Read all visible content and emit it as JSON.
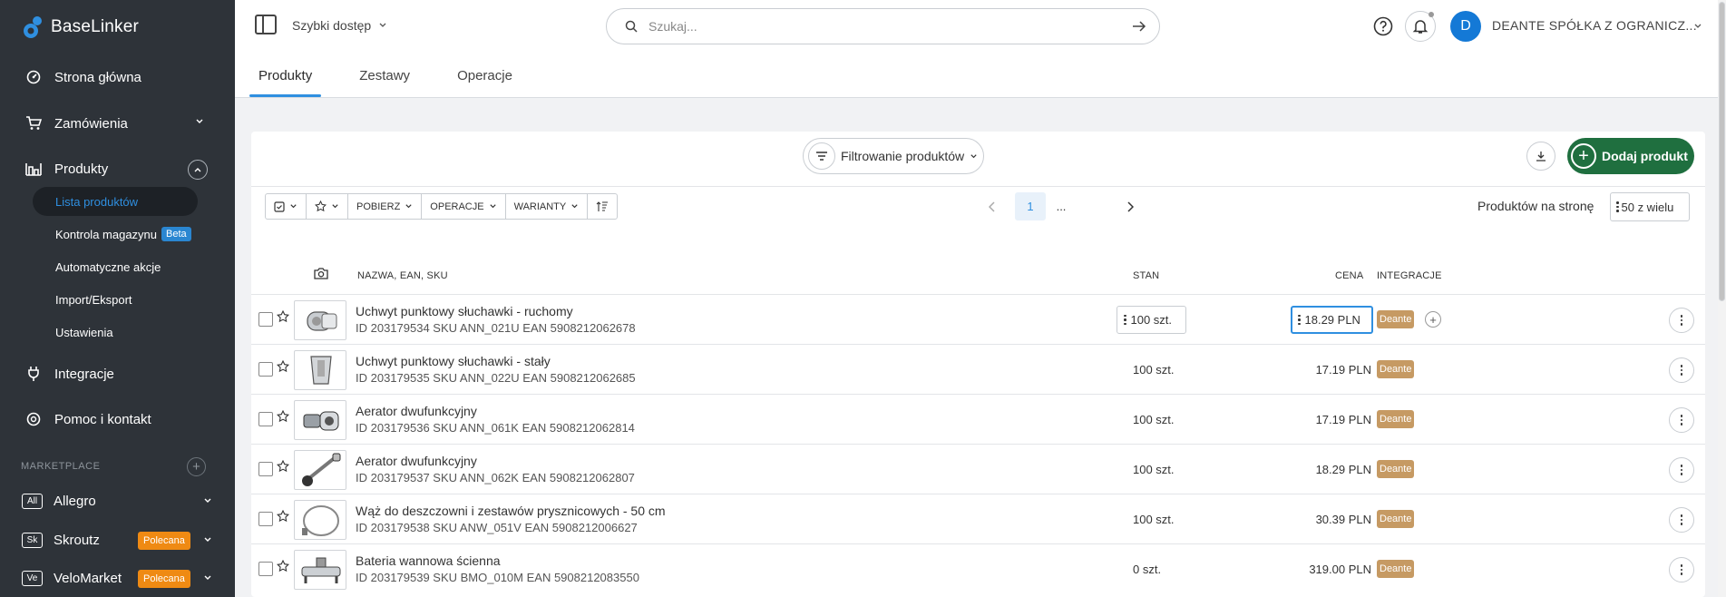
{
  "brand": {
    "name": "BaseLinker"
  },
  "sidebar": {
    "nav": [
      {
        "label": "Strona główna",
        "icon": "dashboard-icon"
      },
      {
        "label": "Zamówienia",
        "icon": "cart-icon"
      },
      {
        "label": "Produkty",
        "icon": "products-icon"
      },
      {
        "label": "Integracje",
        "icon": "plug-icon"
      },
      {
        "label": "Pomoc i kontakt",
        "icon": "help-icon"
      }
    ],
    "product_sub": [
      {
        "label": "Lista produktów"
      },
      {
        "label": "Kontrola magazynu",
        "badge": "Beta"
      },
      {
        "label": "Automatyczne akcje"
      },
      {
        "label": "Import/Eksport"
      },
      {
        "label": "Ustawienia"
      }
    ],
    "marketplace_label": "MARKETPLACE",
    "marketplaces": [
      {
        "badge": "All",
        "label": "Allegro"
      },
      {
        "badge": "Sk",
        "label": "Skroutz",
        "tag": "Polecana"
      },
      {
        "badge": "Ve",
        "label": "VeloMarket",
        "tag": "Polecana"
      }
    ]
  },
  "header": {
    "quick_access": "Szybki dostęp",
    "search_placeholder": "Szukaj...",
    "avatar_initial": "D",
    "company": "DEANTE SPÓŁKA Z OGRANICZ...",
    "tabs": [
      "Produkty",
      "Zestawy",
      "Operacje"
    ]
  },
  "toolbar": {
    "filter_label": "Filtrowanie produktów",
    "add_label": "Dodaj produkt",
    "buttons": [
      "POBIERZ",
      "OPERACJE",
      "WARIANTY"
    ],
    "page_current": "1",
    "page_more": "...",
    "per_page_label": "Produktów na stronę",
    "per_page_value": "50 z wielu"
  },
  "table": {
    "headers": {
      "name": "NAZWA, EAN, SKU",
      "stock": "STAN",
      "price": "CENA",
      "integrations": "INTEGRACJE"
    },
    "rows": [
      {
        "name": "Uchwyt punktowy słuchawki - ruchomy",
        "meta": "ID 203179534 SKU ANN_021U EAN 5908212062678",
        "stock": "100 szt.",
        "price": "18.29 PLN",
        "integration": "Deante",
        "thumb": "holder-mobile"
      },
      {
        "name": "Uchwyt punktowy słuchawki - stały",
        "meta": "ID 203179535 SKU ANN_022U EAN 5908212062685",
        "stock": "100 szt.",
        "price": "17.19 PLN",
        "integration": "Deante",
        "thumb": "holder-fixed"
      },
      {
        "name": "Aerator dwufunkcyjny",
        "meta": "ID 203179536 SKU ANN_061K EAN 5908212062814",
        "stock": "100 szt.",
        "price": "17.19 PLN",
        "integration": "Deante",
        "thumb": "aerator-short"
      },
      {
        "name": "Aerator dwufunkcyjny",
        "meta": "ID 203179537 SKU ANN_062K EAN 5908212062807",
        "stock": "100 szt.",
        "price": "18.29 PLN",
        "integration": "Deante",
        "thumb": "aerator-long"
      },
      {
        "name": "Wąż do deszczowni i zestawów prysznicowych - 50 cm",
        "meta": "ID 203179538 SKU ANW_051V EAN 5908212006627",
        "stock": "100 szt.",
        "price": "30.39 PLN",
        "integration": "Deante",
        "thumb": "hose"
      },
      {
        "name": "Bateria wannowa ścienna",
        "meta": "ID 203179539 SKU BMO_010M EAN 5908212083550",
        "stock": "0 szt.",
        "price": "319.00 PLN",
        "integration": "Deante",
        "thumb": "faucet"
      }
    ]
  },
  "colors": {
    "sidebar": "#2e3339",
    "accent": "#2f8fe0",
    "add_button": "#1f6f3f",
    "integration_badge": "#c69a63",
    "recommended_badge": "#ef8a13"
  }
}
